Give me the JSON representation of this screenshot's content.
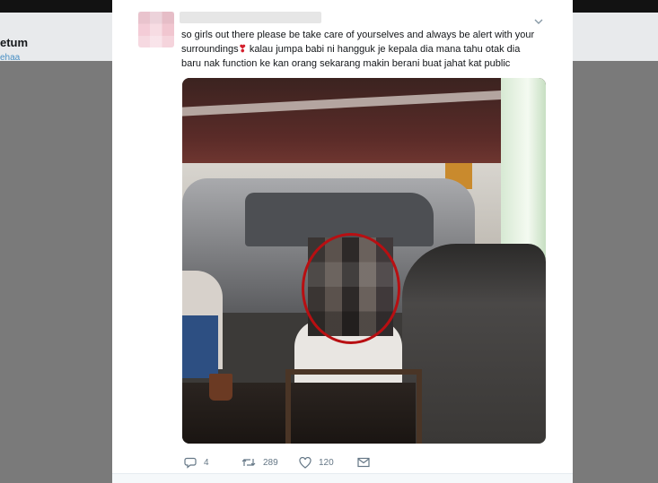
{
  "background": {
    "user_name": "etum",
    "user_handle": "ehaa"
  },
  "tweet": {
    "text_line1": "so girls out there please be take care of yourselves and always be alert with your",
    "text_line2a": "surroundings",
    "emoji": "❣",
    "text_line2b": " kalau jumpa babi ni hangguk je kepala dia mana tahu otak dia",
    "text_line3": "baru nak function ke kan orang sekarang makin berani buat jahat kat public",
    "menu_icon": "chevron-down-icon"
  },
  "actions": {
    "replies": "4",
    "retweets": "289",
    "likes": "120",
    "icons": [
      "reply-icon",
      "retweet-icon",
      "like-icon",
      "message-icon"
    ]
  },
  "colors": {
    "highlight_circle": "#b80f12",
    "icon_gray": "#657786",
    "text": "#14171a"
  }
}
